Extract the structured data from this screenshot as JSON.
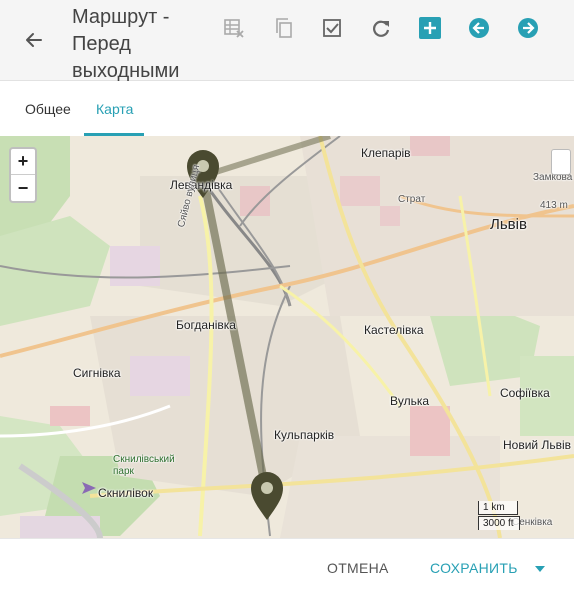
{
  "header": {
    "title": "Маршрут - Перед выходными",
    "icons": [
      "back-arrow-icon",
      "table-delete-icon",
      "copy-icon",
      "checkbox-icon",
      "refresh-icon",
      "plus-square-icon",
      "arrow-left-circle-icon",
      "arrow-right-circle-icon"
    ],
    "accent_color": "#28a0b4"
  },
  "tabs": [
    {
      "label": "Общее",
      "active": false
    },
    {
      "label": "Карта",
      "active": true
    }
  ],
  "map": {
    "zoom_in": "+",
    "zoom_out": "−",
    "places": [
      "Левандівка",
      "Клепарів",
      "Страт",
      "Замкова гора",
      "413 m",
      "Львів",
      "Богданівка",
      "Сигнівка",
      "Кастелівка",
      "Вулька",
      "Софіївка",
      "Кульпарків",
      "Новий Львів",
      "Скнилівський парк",
      "Скнилівок",
      "Сяйво вулиця"
    ],
    "scale": {
      "metric": "1 km",
      "imperial": "3000 ft"
    },
    "tile_label": "Сенківка"
  },
  "footer": {
    "cancel_label": "ОТМЕНА",
    "save_label": "СОХРАНИТЬ"
  }
}
